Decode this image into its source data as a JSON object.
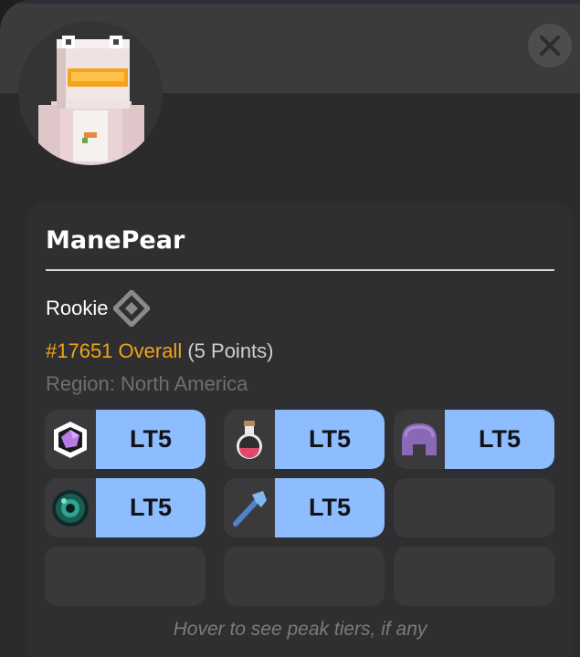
{
  "profile": {
    "name": "ManePear",
    "rank_title": "Rookie",
    "overall_rank": "#17651 Overall",
    "points": "(5 Points)",
    "region": "Region: North America"
  },
  "tiers": [
    {
      "icon": "crystal-icon",
      "label": "LT5"
    },
    {
      "icon": "potion-icon",
      "label": "LT5"
    },
    {
      "icon": "helmet-icon",
      "label": "LT5"
    },
    {
      "icon": "ender-pearl-icon",
      "label": "LT5"
    },
    {
      "icon": "axe-icon",
      "label": "LT5"
    }
  ],
  "footer": {
    "hint": "Hover to see peak tiers, if any"
  },
  "colors": {
    "tier_badge": "#8dbcff",
    "overall_rank": "#f0a419",
    "region": "#6f6f71"
  }
}
